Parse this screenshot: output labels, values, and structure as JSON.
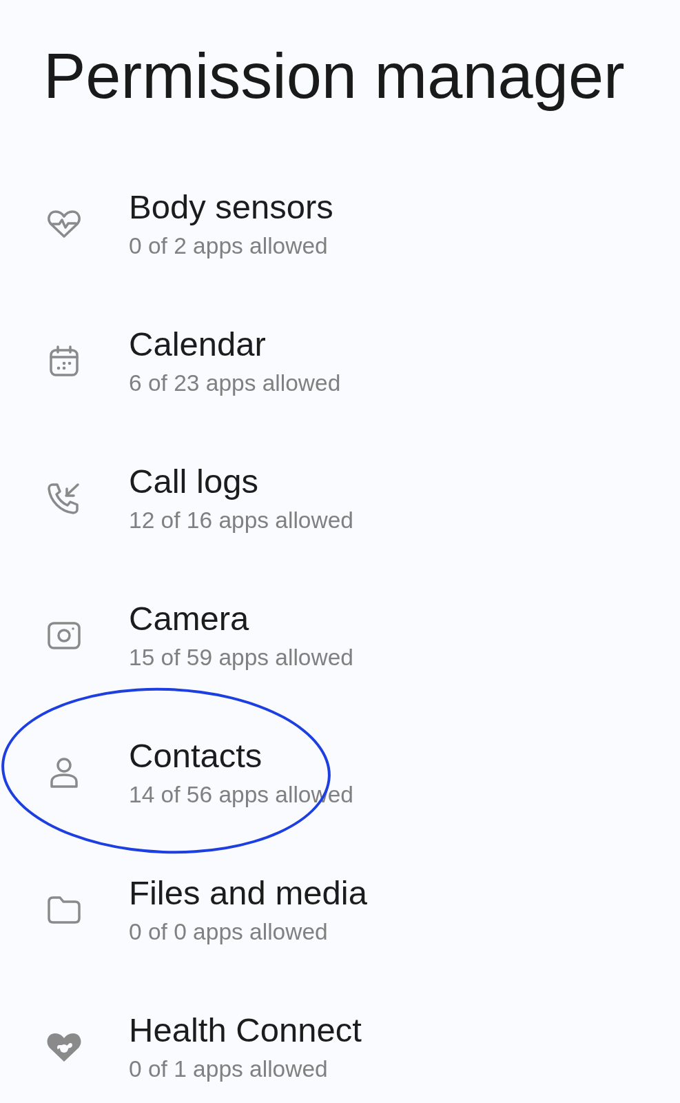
{
  "title": "Permission manager",
  "permissions": [
    {
      "name": "Body sensors",
      "summary": "0 of 2 apps allowed",
      "circled": false
    },
    {
      "name": "Calendar",
      "summary": "6 of 23 apps allowed",
      "circled": false
    },
    {
      "name": "Call logs",
      "summary": "12 of 16 apps allowed",
      "circled": false
    },
    {
      "name": "Camera",
      "summary": "15 of 59 apps allowed",
      "circled": false
    },
    {
      "name": "Contacts",
      "summary": "14 of 56 apps allowed",
      "circled": true
    },
    {
      "name": "Files and media",
      "summary": "0 of 0 apps allowed",
      "circled": false
    },
    {
      "name": "Health Connect",
      "summary": "0 of 1 apps allowed",
      "circled": false
    }
  ]
}
